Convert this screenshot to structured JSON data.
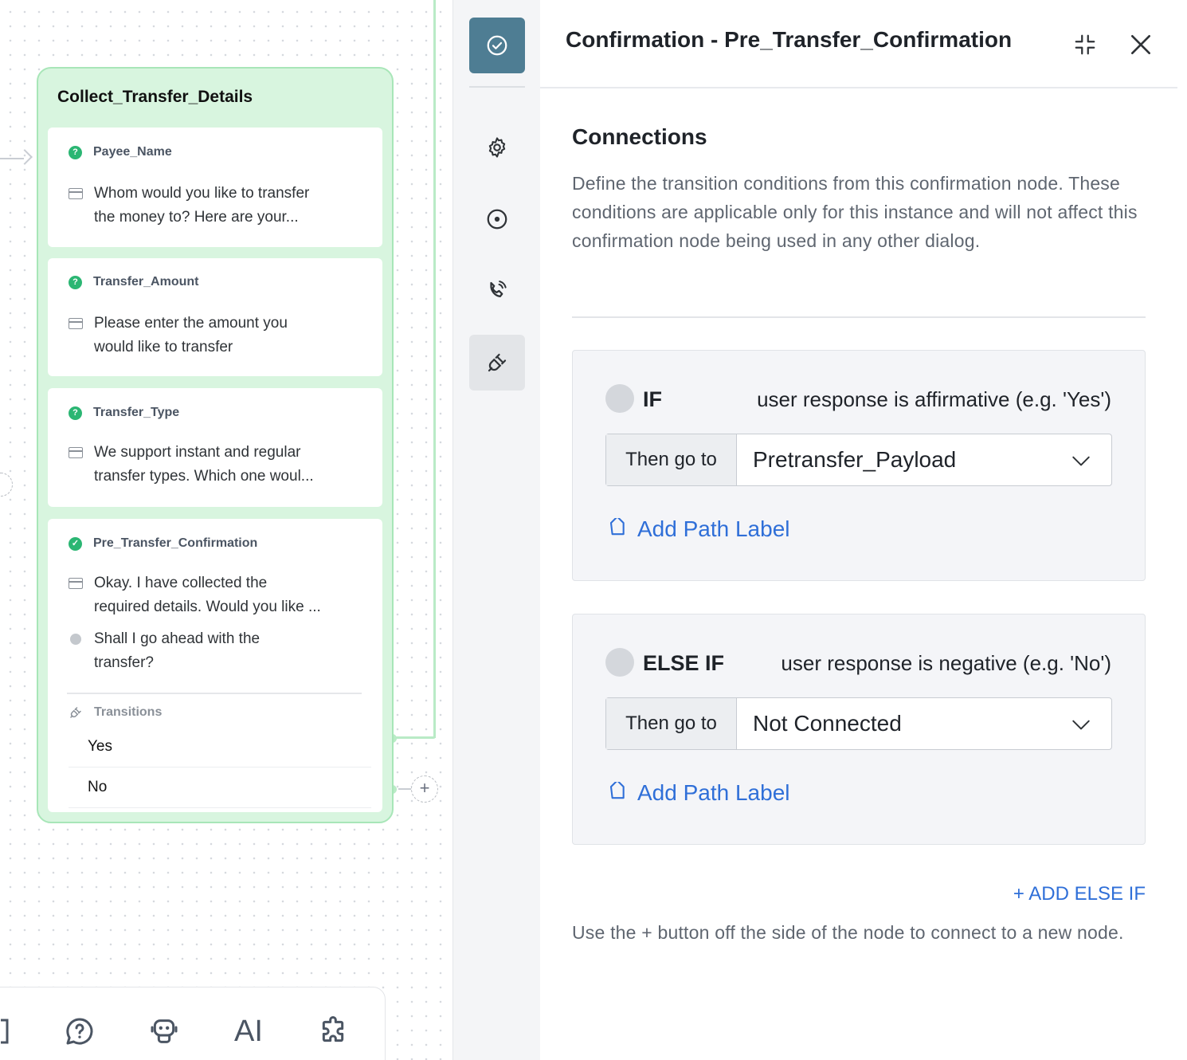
{
  "canvas": {
    "node": {
      "title": "Collect_Transfer_Details",
      "steps": [
        {
          "name": "Payee_Name",
          "line1": "Whom would you like to transfer",
          "line2": "the money to? Here are your..."
        },
        {
          "name": "Transfer_Amount",
          "line1": "Please enter the amount you",
          "line2": "would like to transfer"
        },
        {
          "name": "Transfer_Type",
          "line1": "We support instant and regular",
          "line2": "transfer types. Which one woul..."
        }
      ],
      "confirmation": {
        "name": "Pre_Transfer_Confirmation",
        "message_line1": "Okay. I have collected the",
        "message_line2": "required details. Would you like ...",
        "voice_line1": "Shall I go ahead with the",
        "voice_line2": "transfer?",
        "transitions_label": "Transitions",
        "transitions": [
          "Yes",
          "No"
        ]
      }
    },
    "bottom_bar": {
      "ai_label": "AI",
      "icons": [
        "chat-question-icon",
        "bot-icon",
        "puzzle-icon"
      ]
    }
  },
  "rail": {
    "icons": [
      "check-circle-icon",
      "gear-icon",
      "target-icon",
      "phone-voice-icon",
      "plug-icon"
    ]
  },
  "panel": {
    "title": "Confirmation - Pre_Transfer_Confirmation",
    "section_title": "Connections",
    "description": "Define the transition conditions from this confirmation node. These conditions are applicable only for this instance and will not affect this confirmation node being used in any other dialog.",
    "conditions": [
      {
        "keyword": "IF",
        "text": "user response is affirmative (e.g. 'Yes')",
        "goto_label": "Then go to",
        "goto_value": "Pretransfer_Payload",
        "add_label": "Add Path Label"
      },
      {
        "keyword": "ELSE IF",
        "text": "user response is negative (e.g. 'No')",
        "goto_label": "Then go to",
        "goto_value": "Not Connected",
        "add_label": "Add Path Label"
      }
    ],
    "add_else_if": "+ ADD ELSE IF",
    "footer_note": "Use the + button off the side of the node to connect to a new node.",
    "colors": {
      "accent": "#2f6fd8",
      "rail_active": "#4e7d93",
      "node_bg": "#d8f5df",
      "node_border": "#a8e6b8",
      "success": "#2bb673"
    }
  }
}
